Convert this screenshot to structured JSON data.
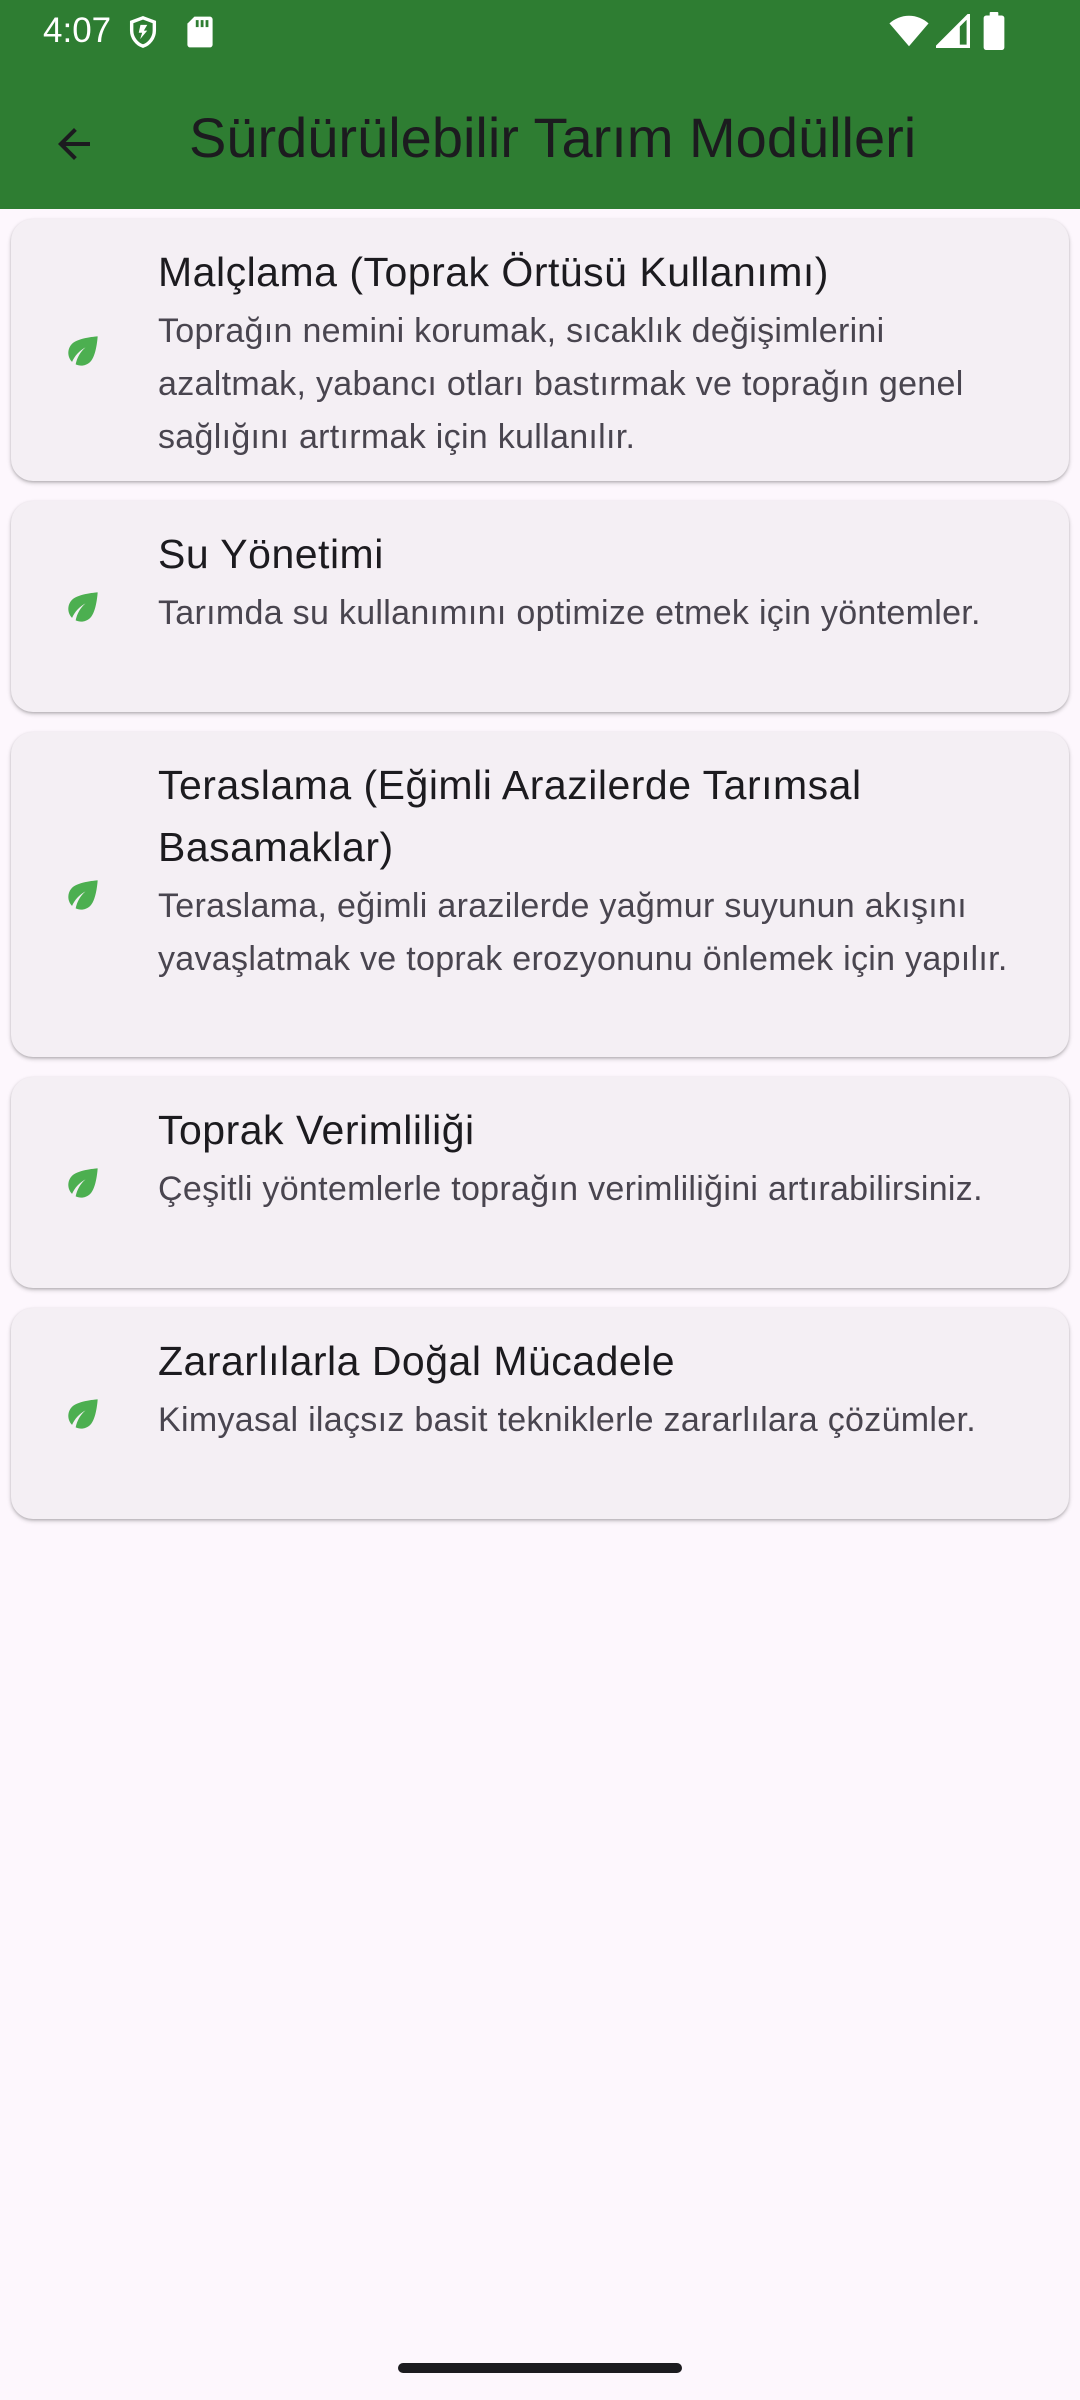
{
  "status_bar": {
    "time": "4:07",
    "icons": [
      "shield-icon",
      "sd-card-icon",
      "wifi-icon",
      "signal-icon",
      "battery-icon"
    ]
  },
  "app_bar": {
    "back_icon": "arrow-back-icon",
    "title": "Sürdürülebilir Tarım Modülleri",
    "background_color": "#2e7d32"
  },
  "modules": [
    {
      "icon": "leaf-icon",
      "title": "Malçlama (Toprak Örtüsü Kullanımı)",
      "subtitle": "Toprağın nemini korumak, sıcaklık değişimlerini azaltmak, yabancı otları bastırmak ve toprağın genel sağlığını artırmak için kullanılır."
    },
    {
      "icon": "leaf-icon",
      "title": "Su Yönetimi",
      "subtitle": "Tarımda su kullanımını optimize etmek için yöntemler."
    },
    {
      "icon": "leaf-icon",
      "title": "Teraslama (Eğimli Arazilerde Tarımsal Basamaklar)",
      "subtitle": "Teraslama, eğimli arazilerde yağmur suyunun akışını yavaşlatmak ve toprak erozyonunu önlemek için yapılır."
    },
    {
      "icon": "leaf-icon",
      "title": "Toprak Verimliliği",
      "subtitle": "Çeşitli yöntemlerle toprağın verimliliğini artırabilirsiniz."
    },
    {
      "icon": "leaf-icon",
      "title": "Zararlılarla Doğal Mücadele",
      "subtitle": "Kimyasal ilaçsız basit tekniklerle zararlılara çözümler."
    }
  ],
  "colors": {
    "accent_green": "#4caf50",
    "card_background": "#f4eff4",
    "page_background": "#fdf7fd"
  }
}
